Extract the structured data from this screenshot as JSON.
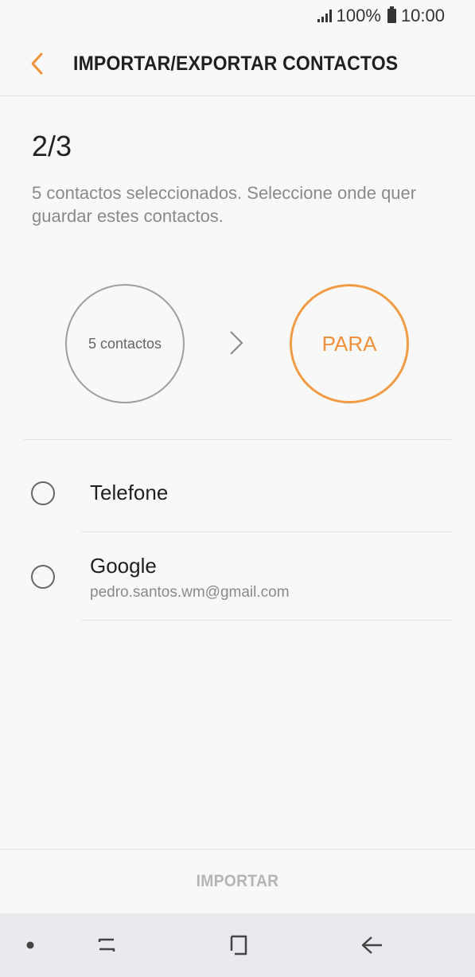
{
  "status_bar": {
    "signal_icon": "signal-icon",
    "battery_percent": "100%",
    "battery_icon": "battery-icon",
    "time": "10:00"
  },
  "app_bar": {
    "back_icon": "back-arrow-icon",
    "title": "IMPORTAR/EXPORTAR CONTACTOS",
    "accent_color": "#f0913a"
  },
  "content": {
    "step": "2/3",
    "description": "5 contactos seleccionados. Seleccione onde quer guardar estes contactos.",
    "source_label": "5 contactos",
    "arrow_icon": "chevron-right-icon",
    "target_label": "PARA"
  },
  "options": [
    {
      "title": "Telefone",
      "subtitle": ""
    },
    {
      "title": "Google",
      "subtitle": "pedro.santos.wm@gmail.com"
    }
  ],
  "footer": {
    "import_label": "IMPORTAR"
  },
  "nav_bar": {
    "items": [
      "dot-icon",
      "recent-apps-icon",
      "home-icon",
      "back-icon"
    ]
  }
}
